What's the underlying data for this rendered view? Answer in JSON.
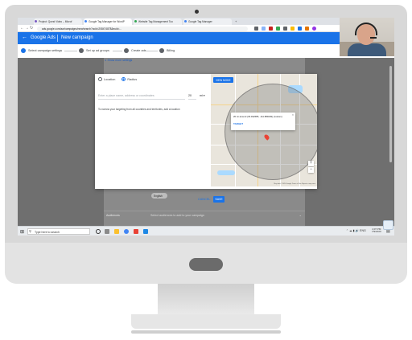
{
  "browser": {
    "tabs": [
      {
        "title": "Project: Quest Video – Microf"
      },
      {
        "title": "Google Tag Manager for WordP"
      },
      {
        "title": "Website Tag Management Too"
      },
      {
        "title": "Google Tag Manager"
      }
    ],
    "address": "ads.google.com/aw/campaigns/new/search?ocid=208474878&euid=..."
  },
  "ads": {
    "product": "Google Ads",
    "page_title": "New campaign"
  },
  "stepper": {
    "steps": [
      {
        "label": "Select campaign settings"
      },
      {
        "label": "Set up ad groups"
      },
      {
        "label": "Create ads"
      },
      {
        "label": "Billing"
      }
    ]
  },
  "page": {
    "show_more": "∨ Show more settings",
    "language_chip": "English",
    "audiences_label": "Audiences",
    "audiences_hint": "Select audiences to add to your campaign"
  },
  "dialog": {
    "option_location": "Location",
    "option_radius": "Radius",
    "search_placeholder": "Enter a place name, address or coordinates",
    "radius_value": "20",
    "unit": "mi",
    "note": "To narrow your targeting from all countries and territories, add a location",
    "view_button": "VIEW MODE",
    "info_text": "20 mi around (33.492685, -111.889449) (custom)",
    "info_action": "TARGET",
    "attribution": "Map data ©2020 Google  Terms of Use  Report a map error",
    "cancel": "CANCEL",
    "save": "SAVE"
  },
  "taskbar": {
    "search_placeholder": "Type here to search",
    "time": "4:07 PM",
    "date": "7/9/2020"
  },
  "colors": {
    "brand": "#1a73e8",
    "overlay": "#6f6f6f"
  }
}
